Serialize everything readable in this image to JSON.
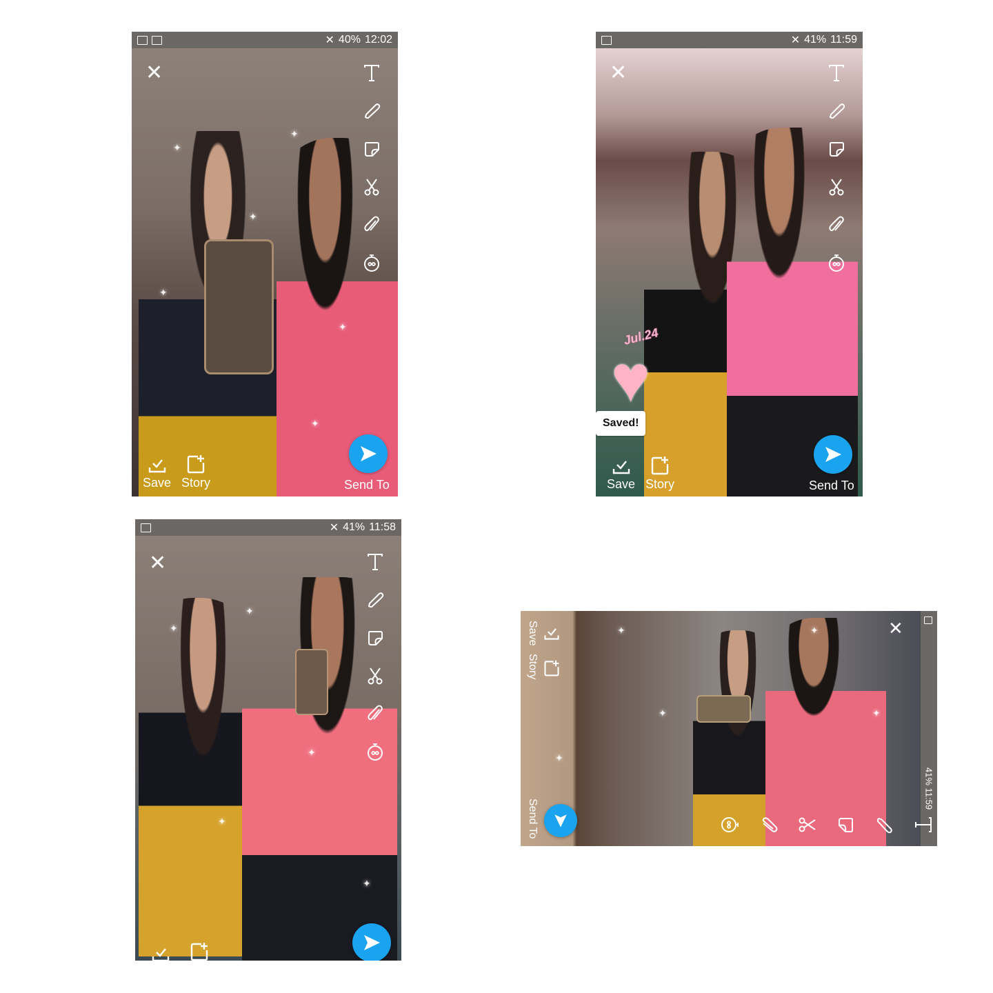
{
  "screens": [
    {
      "id": "tl",
      "status": {
        "battery": "40%",
        "time": "12:02"
      },
      "actions": {
        "save": "Save",
        "story": "Story"
      },
      "send_to": "Send To"
    },
    {
      "id": "tr",
      "status": {
        "battery": "41%",
        "time": "11:59"
      },
      "actions": {
        "save": "Save",
        "story": "Story"
      },
      "send_to": "Send To",
      "toast": "Saved!",
      "sticker_text": "Jul.24"
    },
    {
      "id": "bl",
      "status": {
        "battery": "41%",
        "time": "11:58"
      }
    },
    {
      "id": "br",
      "status": {
        "battery": "41%",
        "time": "11:59"
      },
      "actions": {
        "save": "Save",
        "story": "Story"
      },
      "send_to": "Send To"
    }
  ],
  "icons": [
    "close-icon",
    "text-tool-icon",
    "pencil-icon",
    "sticker-icon",
    "scissors-icon",
    "paperclip-icon",
    "timer-icon",
    "save-icon",
    "story-add-icon",
    "send-arrow-icon"
  ],
  "colors": {
    "send_blue": "#1aa3ee",
    "status_gray": "#6b6765"
  }
}
